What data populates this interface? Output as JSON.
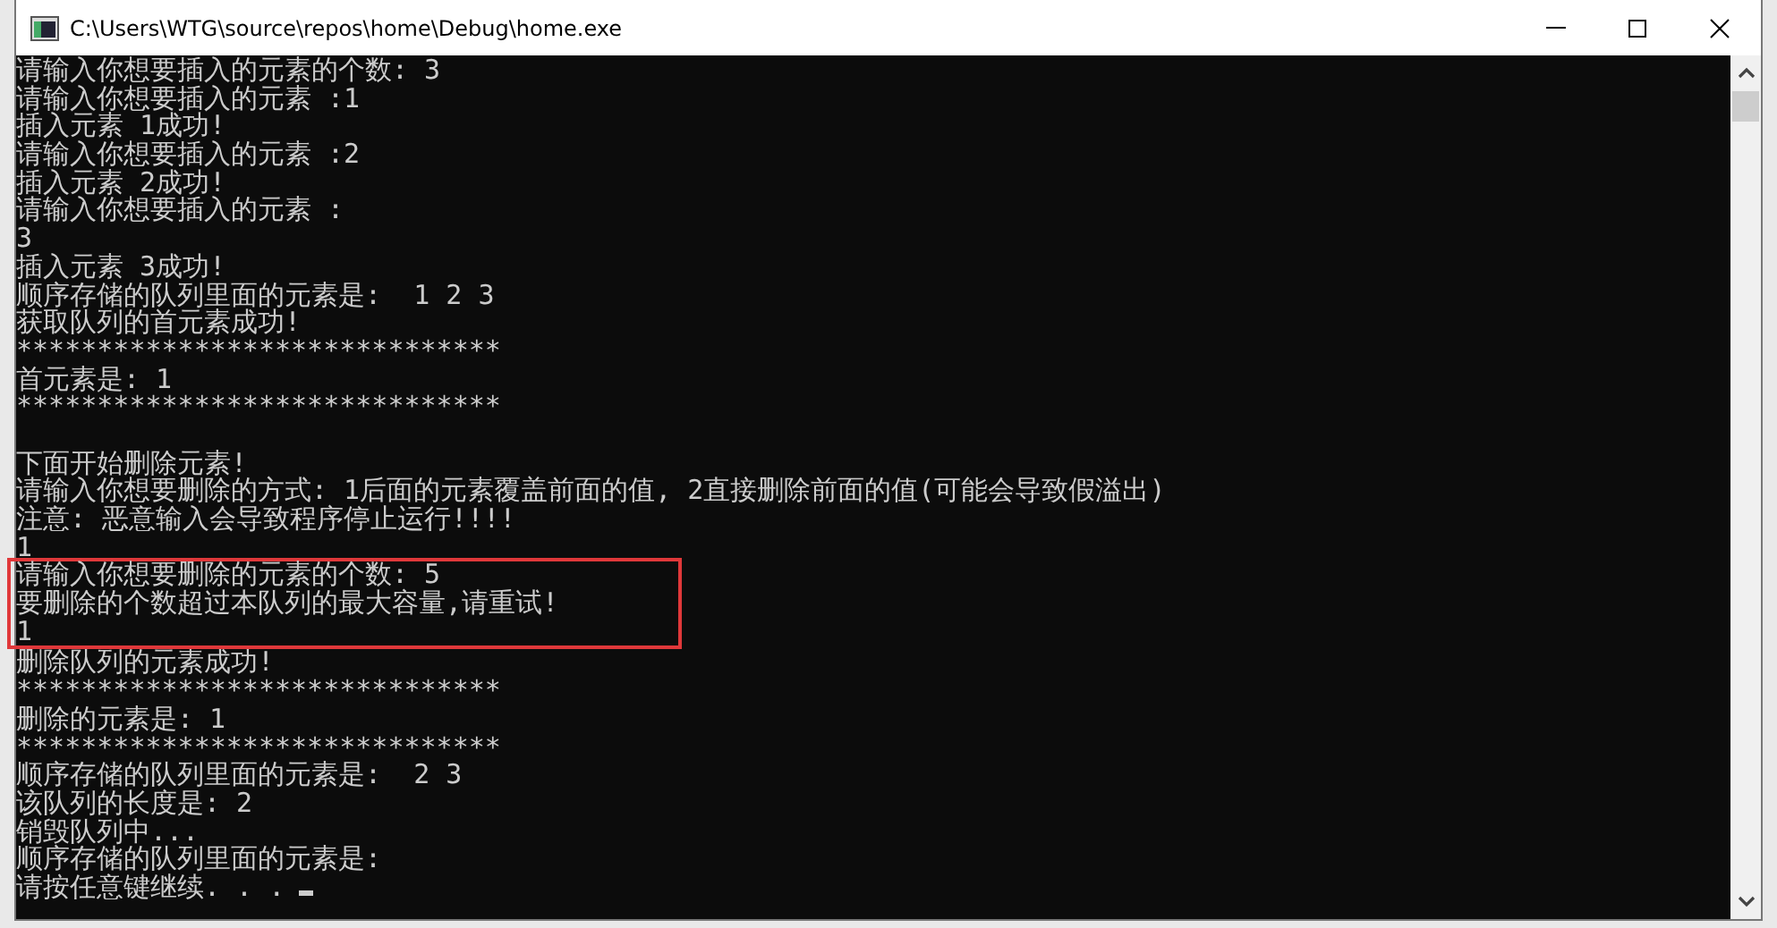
{
  "window": {
    "title": "C:\\Users\\WTG\\source\\repos\\home\\Debug\\home.exe"
  },
  "console": {
    "blocks": [
      {
        "kind": "plain",
        "lines": [
          {
            "kind": "text",
            "text": "请输入你想要插入的元素的个数: 3"
          },
          {
            "kind": "text",
            "text": "请输入你想要插入的元素 :1"
          },
          {
            "kind": "text",
            "text": "插入元素 1成功!"
          },
          {
            "kind": "text",
            "text": "请输入你想要插入的元素 :2"
          },
          {
            "kind": "text",
            "text": "插入元素 2成功!"
          },
          {
            "kind": "text",
            "text": "请输入你想要插入的元素 :"
          },
          {
            "kind": "text",
            "text": "3"
          },
          {
            "kind": "text",
            "text": "插入元素 3成功!"
          },
          {
            "kind": "text",
            "text": "顺序存储的队列里面的元素是:  1 2 3"
          },
          {
            "kind": "text",
            "text": "获取队列的首元素成功!"
          },
          {
            "kind": "text",
            "text": "******************************"
          },
          {
            "kind": "text",
            "text": "首元素是: 1"
          },
          {
            "kind": "text",
            "text": "******************************"
          },
          {
            "kind": "blank"
          },
          {
            "kind": "text",
            "text": "下面开始删除元素!"
          },
          {
            "kind": "text",
            "text": "请输入你想要删除的方式: 1后面的元素覆盖前面的值, 2直接删除前面的值(可能会导致假溢出)"
          },
          {
            "kind": "text",
            "text": "注意: 恶意输入会导致程序停止运行!!!!"
          },
          {
            "kind": "text",
            "text": "1"
          }
        ]
      },
      {
        "kind": "highlighted",
        "lines": [
          {
            "kind": "text",
            "text": "请输入你想要删除的元素的个数: 5"
          },
          {
            "kind": "text",
            "text": "要删除的个数超过本队列的最大容量,请重试!"
          },
          {
            "kind": "text",
            "text": "1"
          }
        ]
      },
      {
        "kind": "plain",
        "lines": [
          {
            "kind": "text",
            "text": "删除队列的元素成功!"
          },
          {
            "kind": "text",
            "text": "******************************"
          },
          {
            "kind": "text",
            "text": "删除的元素是: 1"
          },
          {
            "kind": "text",
            "text": "******************************"
          },
          {
            "kind": "text",
            "text": "顺序存储的队列里面的元素是:  2 3"
          },
          {
            "kind": "text",
            "text": "该队列的长度是: 2"
          },
          {
            "kind": "text",
            "text": "销毁队列中..."
          },
          {
            "kind": "text",
            "text": "顺序存储的队列里面的元素是:"
          },
          {
            "kind": "prompt",
            "text": "请按任意键继续. . ."
          }
        ]
      }
    ]
  }
}
